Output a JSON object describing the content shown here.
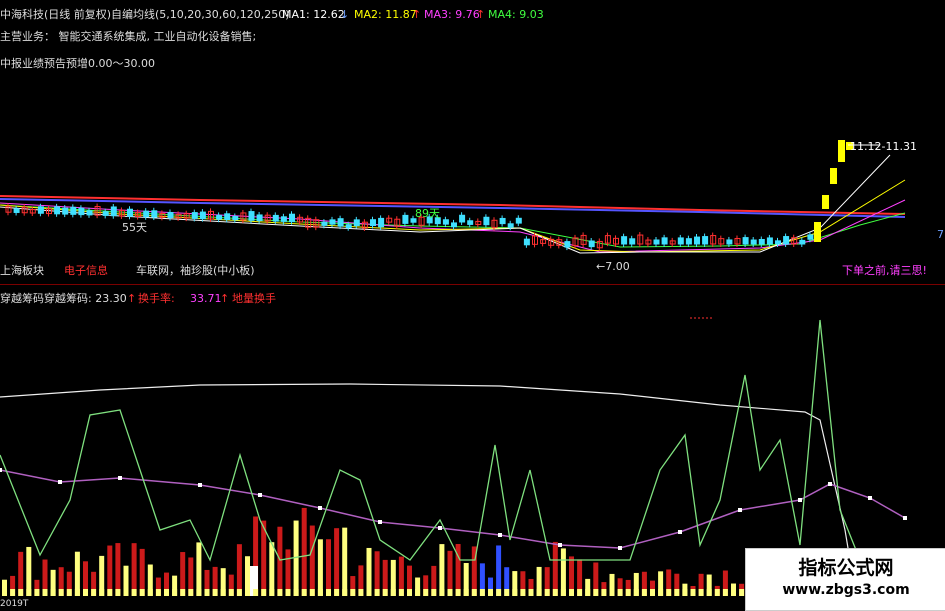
{
  "header": {
    "title": "中海科技(日线 前复权)",
    "ma_label": "自编均线(5,10,20,30,60,120,250)",
    "ma1": "MA1: 12.62",
    "ma1_arrow": "↓",
    "ma2": "MA2: 11.87",
    "ma2_arrow": "↑",
    "ma3": "MA3: 9.76",
    "ma3_arrow": "↑",
    "ma4": "MA4: 9.03",
    "ma1_color": "#ffffff",
    "ma2_color": "#ffff00",
    "ma3_color": "#ff00ff",
    "ma4_color": "#00ff00"
  },
  "info": {
    "business": "主营业务：   智能交通系统集成, 工业自动化设备销售;",
    "forecast": "中报业绩预告预增0.00～30.00"
  },
  "price_panel": {
    "label_55": "55天",
    "label_89": "89天",
    "label_low": "←7.00",
    "label_range": "11.12-11.31",
    "right_edge": "7"
  },
  "sector": {
    "board": "上海板块",
    "industry": "电子信息",
    "concepts": "车联网，袖珍股(中小板)",
    "warning": "下单之前,请三思!"
  },
  "indicator": {
    "name": "穿越筹码",
    "value_label": "穿越筹码: 23.30",
    "value_arrow": "↑",
    "turnover_label": "换手率:",
    "turnover_value": "33.71",
    "turnover_arrow": "↑",
    "low_turnover": "地量换手"
  },
  "bottom": {
    "date_fragment": "2019T"
  },
  "watermark": {
    "title": "指标公式网",
    "url": "www.zbgs3.com"
  }
}
